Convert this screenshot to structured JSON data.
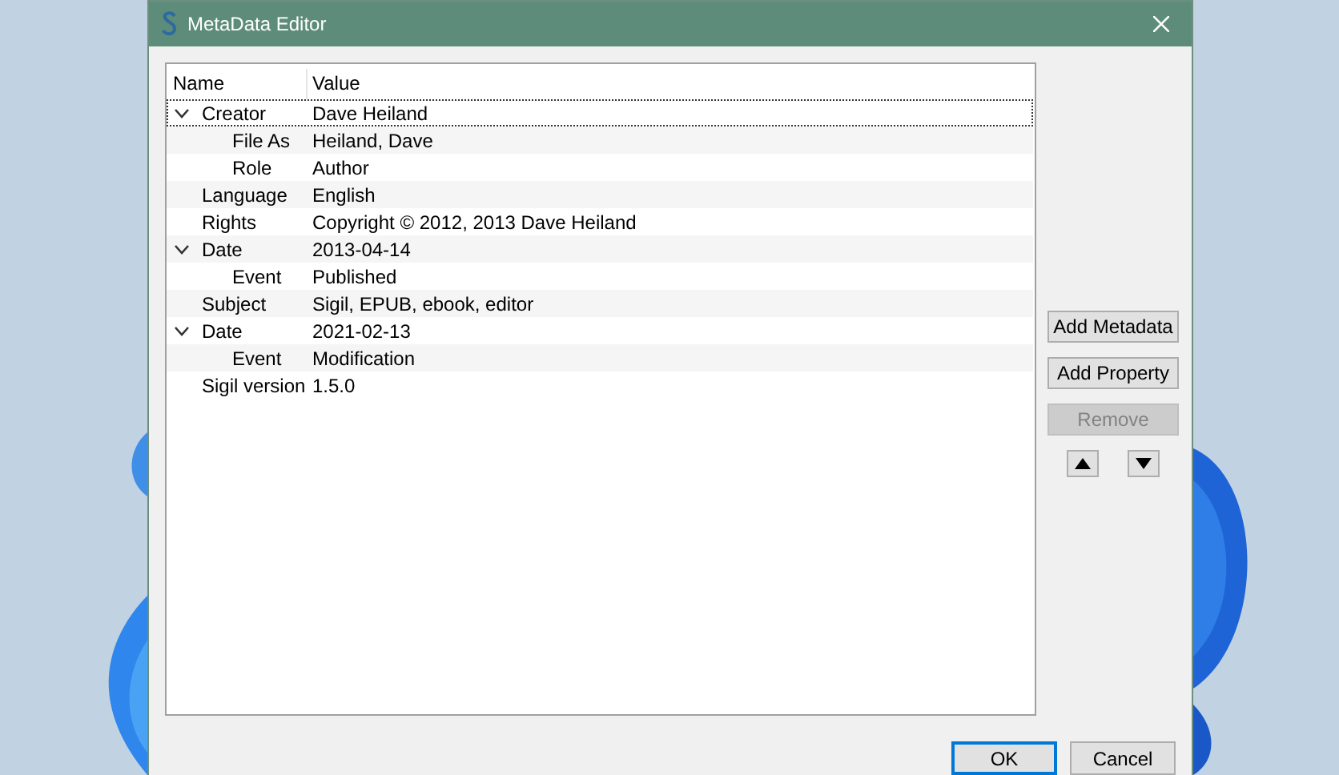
{
  "window": {
    "title": "MetaData Editor"
  },
  "tree": {
    "columns": [
      "Name",
      "Value"
    ],
    "rows": [
      {
        "name": "Creator",
        "value": "Dave Heiland",
        "selected": true,
        "expanded": true,
        "children": [
          {
            "name": "File As",
            "value": "Heiland, Dave",
            "selected": false
          },
          {
            "name": "Role",
            "value": "Author",
            "selected": false
          }
        ]
      },
      {
        "name": "Language",
        "value": "English",
        "selected": false
      },
      {
        "name": "Rights",
        "value": "Copyright © 2012, 2013 Dave Heiland",
        "selected": false
      },
      {
        "name": "Date",
        "value": "2013-04-14",
        "selected": false,
        "expanded": true,
        "children": [
          {
            "name": "Event",
            "value": "Published",
            "selected": false
          }
        ]
      },
      {
        "name": "Subject",
        "value": "Sigil, EPUB, ebook, editor",
        "selected": false
      },
      {
        "name": "Date",
        "value": "2021-02-13",
        "selected": false,
        "expanded": true,
        "children": [
          {
            "name": "Event",
            "value": "Modification",
            "selected": false
          }
        ]
      },
      {
        "name": "Sigil version",
        "value": "1.5.0",
        "selected": false
      }
    ]
  },
  "side_buttons": [
    {
      "label": "Add Metadata",
      "disabled": false
    },
    {
      "label": "Add Property",
      "disabled": false
    },
    {
      "label": "Remove",
      "disabled": true
    }
  ],
  "dialog_buttons": [
    {
      "label": "OK",
      "default": true
    },
    {
      "label": "Cancel",
      "default": false
    }
  ]
}
